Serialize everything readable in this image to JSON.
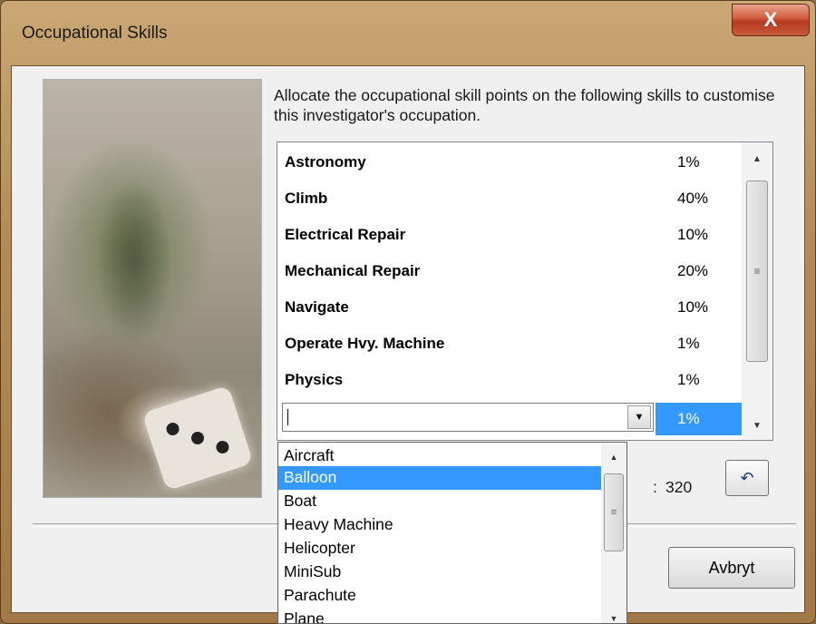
{
  "window": {
    "title": "Occupational Skills",
    "close_glyph": "X"
  },
  "instructions": "Allocate the occupational skill points on the following skills to customise this investigator's occupation.",
  "skills": [
    {
      "name": "Astronomy",
      "value": "1%"
    },
    {
      "name": "Climb",
      "value": "40%"
    },
    {
      "name": "Electrical Repair",
      "value": "10%"
    },
    {
      "name": "Mechanical Repair",
      "value": "20%"
    },
    {
      "name": "Navigate",
      "value": "10%"
    },
    {
      "name": "Operate Hvy. Machine",
      "value": "1%"
    },
    {
      "name": "Physics",
      "value": "1%"
    }
  ],
  "editing_row": {
    "combo_value": "",
    "value": "1%"
  },
  "dropdown": {
    "items": [
      "Aircraft",
      "Balloon",
      "Boat",
      "Heavy Machine",
      "Helicopter",
      "MiniSub",
      "Parachute",
      "Plane"
    ],
    "selected": "Balloon"
  },
  "points": {
    "remaining": "320",
    "colon": ":"
  },
  "buttons": {
    "cancel_label": "Avbryt",
    "undo_icon": "undo-icon"
  },
  "colors": {
    "selection": "#3399ff",
    "close_button": "#c8482c"
  }
}
